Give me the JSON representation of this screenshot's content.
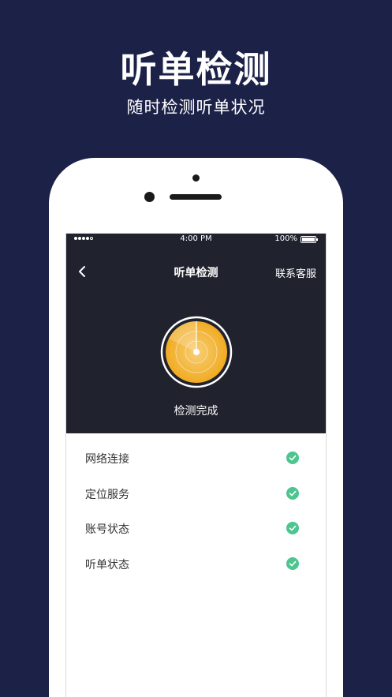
{
  "promo": {
    "title": "听单检测",
    "subtitle": "随时检测听单状况"
  },
  "status_bar": {
    "time": "4:00 PM",
    "battery": "100%",
    "signal_icon": "signal-dots-icon",
    "battery_icon": "battery-icon"
  },
  "nav": {
    "back_icon": "chevron-left-icon",
    "title": "听单检测",
    "contact_label": "联系客服"
  },
  "radar": {
    "status": "检测完成",
    "icon": "radar-icon",
    "color": "#f2b130"
  },
  "checks": [
    {
      "label": "网络连接",
      "status": "ok"
    },
    {
      "label": "定位服务",
      "status": "ok"
    },
    {
      "label": "账号状态",
      "status": "ok"
    },
    {
      "label": "听单状态",
      "status": "ok"
    }
  ],
  "colors": {
    "background": "#1c2148",
    "header": "#20232e",
    "check": "#4cc58f",
    "accent": "#f2b130"
  }
}
